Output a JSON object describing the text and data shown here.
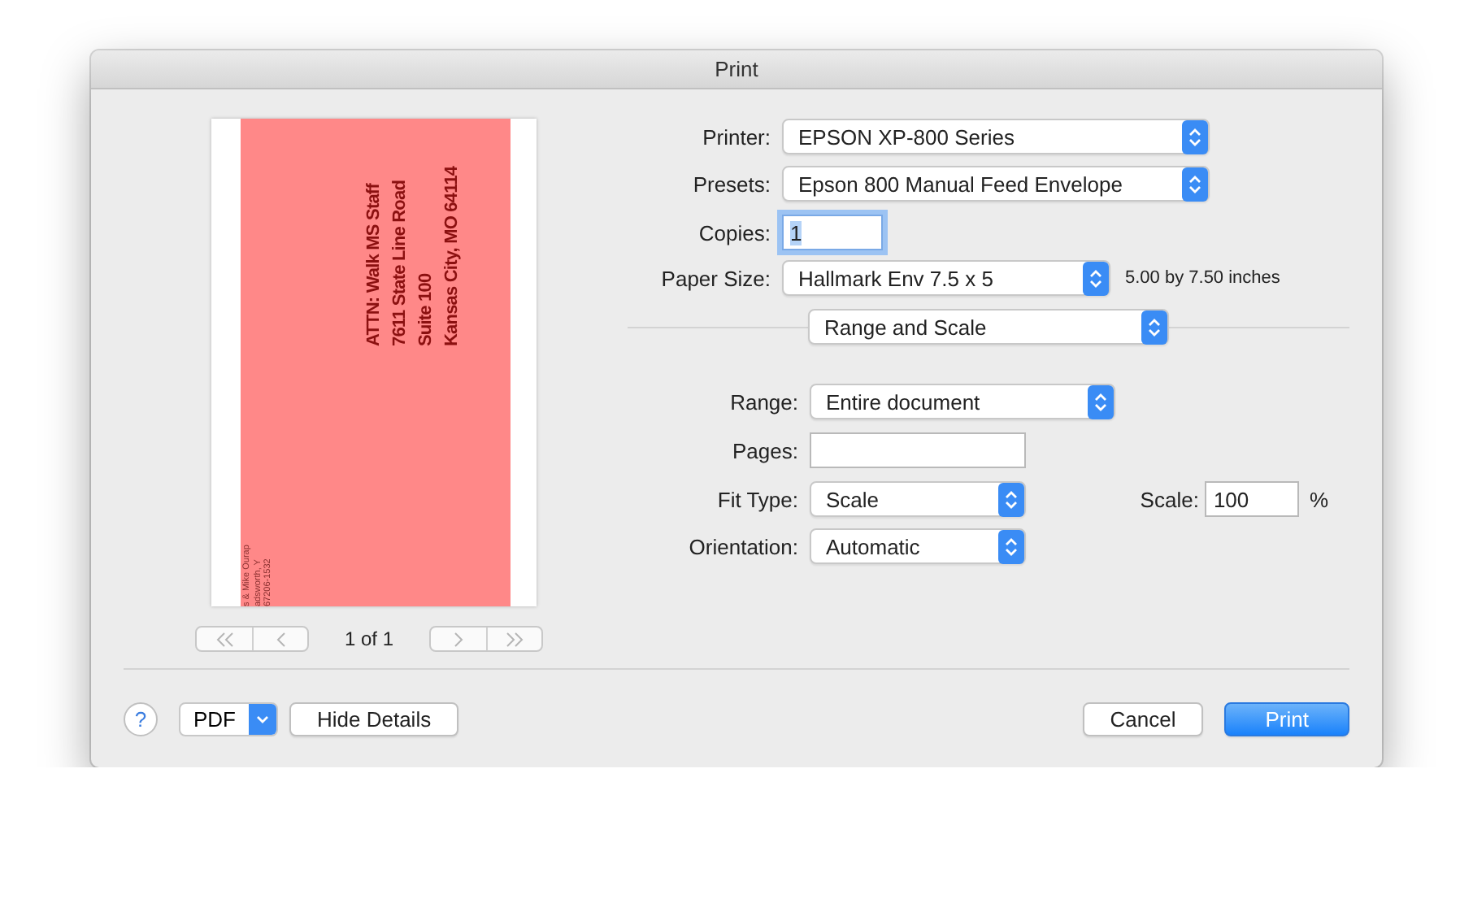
{
  "window": {
    "title": "Print"
  },
  "preview": {
    "recipient_lines": [
      "ATTN: Walk MS Staff",
      "7611 State Line Road",
      "Suite 100",
      "Kansas City, MO 64114"
    ],
    "return_address_lines": [
      "s & Mike Ourap",
      "adsworth, Y",
      "67206-1532"
    ],
    "page_indicator": "1 of 1",
    "page_nav": [
      {
        "kind": "first",
        "disabled": true
      },
      {
        "kind": "previous",
        "disabled": true
      },
      {
        "kind": "next",
        "disabled": true
      },
      {
        "kind": "last",
        "disabled": true
      }
    ]
  },
  "settings": [
    {
      "kind": "popup",
      "label": "Printer:",
      "value": "EPSON XP-800 Series"
    },
    {
      "kind": "popup",
      "label": "Presets:",
      "value": "Epson 800 Manual Feed Envelope"
    },
    {
      "kind": "field",
      "label": "Copies:",
      "value": "1",
      "focused": true
    },
    {
      "kind": "popup",
      "label": "Paper Size:",
      "value": "Hallmark Env 7.5 x 5",
      "note": "5.00 by 7.50 inches"
    }
  ],
  "section_popup": {
    "value": "Range and Scale"
  },
  "section_rows": [
    {
      "kind": "popup",
      "label": "Range:",
      "value": "Entire document"
    },
    {
      "kind": "field",
      "label": "Pages:"
    },
    {
      "kind": "popup",
      "label": "Fit Type:",
      "value": "Scale",
      "side": {
        "label": "Scale:",
        "value": "100",
        "unit": "%"
      }
    },
    {
      "kind": "popup",
      "label": "Orientation:",
      "value": "Automatic"
    }
  ],
  "footer": {
    "help": "?",
    "pdf": "PDF",
    "buttons": [
      {
        "label": "Hide Details",
        "default": false
      }
    ],
    "actions": [
      {
        "label": "Cancel",
        "default": false
      },
      {
        "label": "Print",
        "default": true
      }
    ]
  }
}
